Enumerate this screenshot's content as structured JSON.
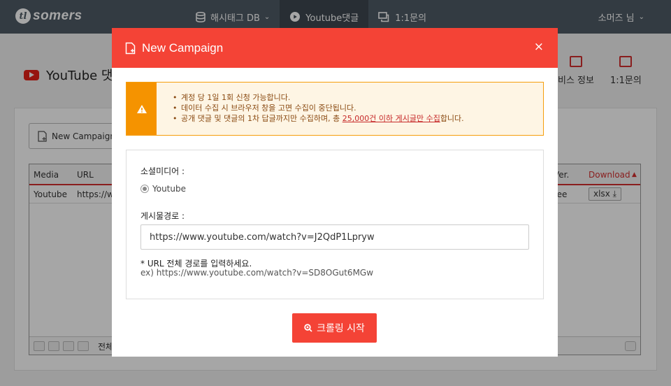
{
  "brand": {
    "logo_mark": "tl",
    "name": "somers"
  },
  "nav": {
    "items": [
      {
        "label": "해시태그 DB",
        "icon": "database-icon",
        "has_caret": true
      },
      {
        "label": "Youtube댓글",
        "icon": "youtube-icon",
        "active": true
      },
      {
        "label": "1:1문의",
        "icon": "chat-icon"
      }
    ],
    "user": "소머즈 님"
  },
  "page": {
    "title": "YouTube 댓",
    "quick_links": [
      "비스 정보",
      "1:1문의"
    ],
    "new_campaign_label": "New Campaign",
    "grid": {
      "columns": [
        "Media",
        "URL",
        "Ver.",
        "Download"
      ],
      "sort_indicator": "▲",
      "rows": [
        {
          "media": "Youtube",
          "url": "https://w",
          "ver": "ree",
          "download": "xlsx"
        }
      ],
      "footer_text": "전체"
    }
  },
  "modal": {
    "title": "New Campaign",
    "close": "×",
    "alert": {
      "lines": [
        "계정 당 1일 1회 신청 가능합니다.",
        "데이터 수집 시 브라우저 창을 고면 수집이 중단됩니다."
      ],
      "line3_prefix": "공개 댓글 및 댓글의 1차 답글까지만 수집하며, 총 ",
      "line3_link": "25,000건 이하 게시글만 수집",
      "line3_suffix": "합니다."
    },
    "form": {
      "social_label": "소셜미디어 :",
      "social_option": "Youtube",
      "url_label": "게시물경로 :",
      "url_value": "https://www.youtube.com/watch?v=J2QdP1Lpryw",
      "hint": "* URL 전체 경로를 입력하세요.",
      "example": "ex) https://www.youtube.com/watch?v=SD8OGut6MGw"
    },
    "submit_label": "크롤링 시작"
  },
  "colors": {
    "primary": "#f44336",
    "nav_bg": "#4f5b66",
    "warning": "#f59300"
  }
}
